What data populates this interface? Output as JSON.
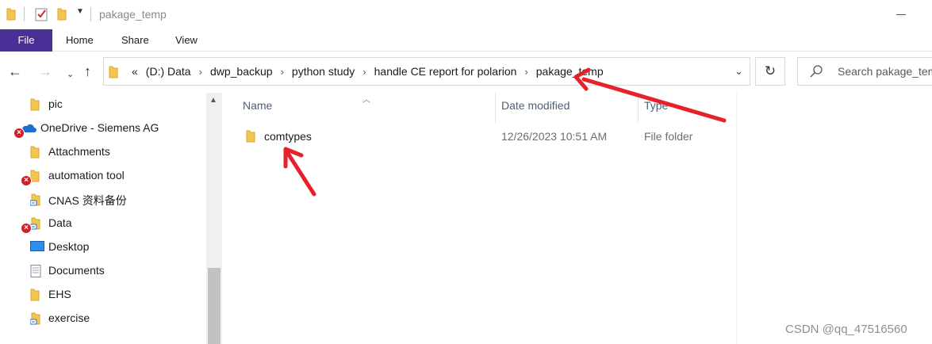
{
  "window": {
    "title": "pakage_temp"
  },
  "ribbon": {
    "tabs": [
      "File",
      "Home",
      "Share",
      "View"
    ]
  },
  "address_bar": {
    "overflow": "«",
    "crumbs": [
      "(D:) Data",
      "dwp_backup",
      "python study",
      "handle CE report for polarion",
      "pakage_temp"
    ],
    "separator": "›"
  },
  "search": {
    "placeholder": "Search pakage_temp"
  },
  "nav_pane": {
    "items": [
      {
        "label": "pic",
        "icon": "folder-icon",
        "error": false
      },
      {
        "label": "OneDrive - Siemens AG",
        "icon": "onedrive-cloud-icon",
        "error": true
      },
      {
        "label": "Attachments",
        "icon": "folder-icon",
        "error": false
      },
      {
        "label": "automation tool",
        "icon": "folder-icon",
        "error": true
      },
      {
        "label": "CNAS 资料备份",
        "icon": "shared-folder-icon",
        "error": false
      },
      {
        "label": "Data",
        "icon": "shared-folder-icon",
        "error": true
      },
      {
        "label": "Desktop",
        "icon": "desktop-icon",
        "error": false
      },
      {
        "label": "Documents",
        "icon": "documents-icon",
        "error": false
      },
      {
        "label": "EHS",
        "icon": "folder-icon",
        "error": false
      },
      {
        "label": "exercise",
        "icon": "shared-folder-icon",
        "error": false
      }
    ]
  },
  "file_list": {
    "columns": [
      "Name",
      "Date modified",
      "Type"
    ],
    "rows": [
      {
        "name": "comtypes",
        "date": "12/26/2023 10:51 AM",
        "type": "File folder"
      }
    ]
  },
  "annotations": {
    "arrow_color": "#e8202a"
  },
  "watermark": "CSDN @qq_47516560",
  "colors": {
    "file_tab": "#4a2f96",
    "folder": "#f3c64e",
    "column_header": "#4c607a",
    "error_badge": "#d21f2a"
  }
}
